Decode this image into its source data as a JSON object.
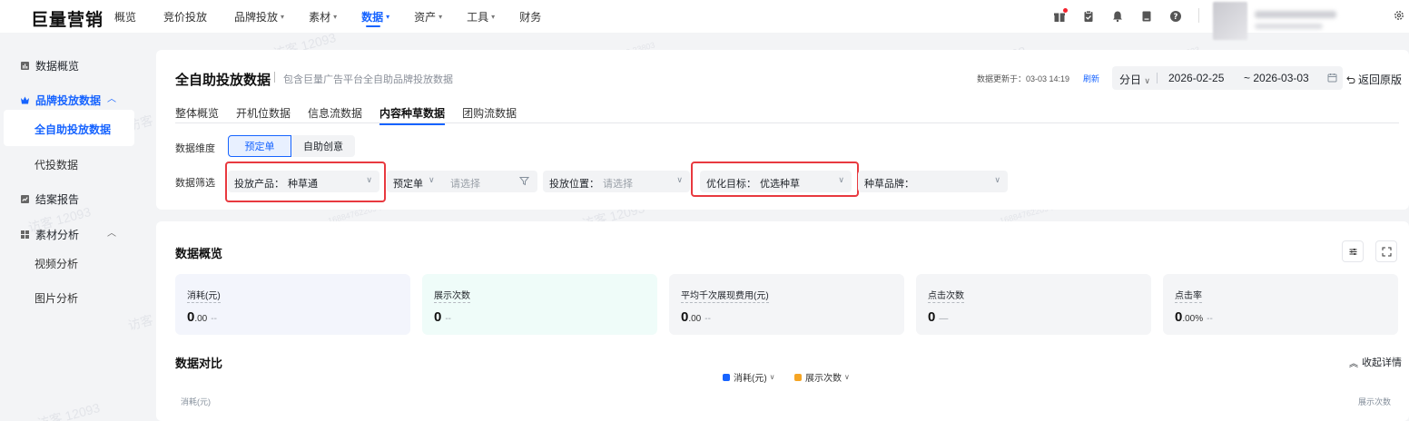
{
  "app": {
    "logo": "巨量营销"
  },
  "topnav": {
    "items": [
      {
        "label": "概览",
        "caret": ""
      },
      {
        "label": "竞价投放",
        "caret": ""
      },
      {
        "label": "品牌投放",
        "caret": "▾"
      },
      {
        "label": "素材",
        "caret": "▾"
      },
      {
        "label": "数据",
        "caret": "▾"
      },
      {
        "label": "资产",
        "caret": "▾"
      },
      {
        "label": "工具",
        "caret": "▾"
      },
      {
        "label": "财务",
        "caret": ""
      }
    ],
    "active_index": 4,
    "icons": [
      "gift-icon",
      "clipboard-icon",
      "bell-icon",
      "document-icon",
      "help-icon"
    ]
  },
  "sidebar": {
    "items": [
      {
        "label": "数据概览",
        "icon": "bar-chart-icon"
      },
      {
        "label": "品牌投放数据",
        "icon": "crown-icon",
        "chevron": "^"
      },
      {
        "label": "全自助投放数据"
      },
      {
        "label": "代投数据"
      },
      {
        "label": "结案报告",
        "icon": "report-icon"
      },
      {
        "label": "素材分析",
        "icon": "grid-icon",
        "chevron": "^"
      },
      {
        "label": "视频分析"
      },
      {
        "label": "图片分析"
      }
    ]
  },
  "header": {
    "title": "全自助投放数据",
    "subtitle": "包含巨量广告平台全自助品牌投放数据",
    "update_label": "数据更新于：03-03 14:19",
    "refresh": "刷新",
    "granularity": "分日",
    "date_start": "2026-02-25",
    "date_end": "~ 2026-03-03",
    "back": "返回原版"
  },
  "tabs": [
    "整体概览",
    "开机位数据",
    "信息流数据",
    "内容种草数据",
    "团购流数据"
  ],
  "active_tab": 3,
  "dimension": {
    "label": "数据维度",
    "options": [
      "预定单",
      "自助创意"
    ],
    "selected": "预定单"
  },
  "filters": {
    "label": "数据筛选",
    "product": {
      "label": "投放产品：",
      "value": "种草通"
    },
    "order": {
      "label": "预定单",
      "placeholder": "请选择"
    },
    "position": {
      "label": "投放位置：",
      "placeholder": "请选择"
    },
    "goal": {
      "label": "优化目标：",
      "value": "优选种草"
    },
    "brand": {
      "label": "种草品牌："
    }
  },
  "overview": {
    "title": "数据概览",
    "cards": [
      {
        "label": "消耗(元)",
        "value": "0",
        "unit": ".00",
        "delta": "--",
        "bg": "#f3f5fc"
      },
      {
        "label": "展示次数",
        "value": "0",
        "unit": "",
        "delta": "--",
        "bg": "#effcf9"
      },
      {
        "label": "平均千次展现费用(元)",
        "value": "0",
        "unit": ".00",
        "delta": "--",
        "bg": "#f4f5f7"
      },
      {
        "label": "点击次数",
        "value": "0",
        "unit": "",
        "delta": "—",
        "bg": "#f4f5f7"
      },
      {
        "label": "点击率",
        "value": "0",
        "unit": ".00%",
        "delta": "--",
        "bg": "#f4f5f7"
      }
    ]
  },
  "compare": {
    "title": "数据对比",
    "collapse": "收起详情",
    "legend": [
      {
        "label": "消耗(元)",
        "color": "#1764ff"
      },
      {
        "label": "展示次数",
        "color": "#f5a524"
      }
    ],
    "y_left": "消耗(元)",
    "y_right": "展示次数"
  },
  "watermark": {
    "text": "访客 12093",
    "id": "16884762209 23803"
  }
}
